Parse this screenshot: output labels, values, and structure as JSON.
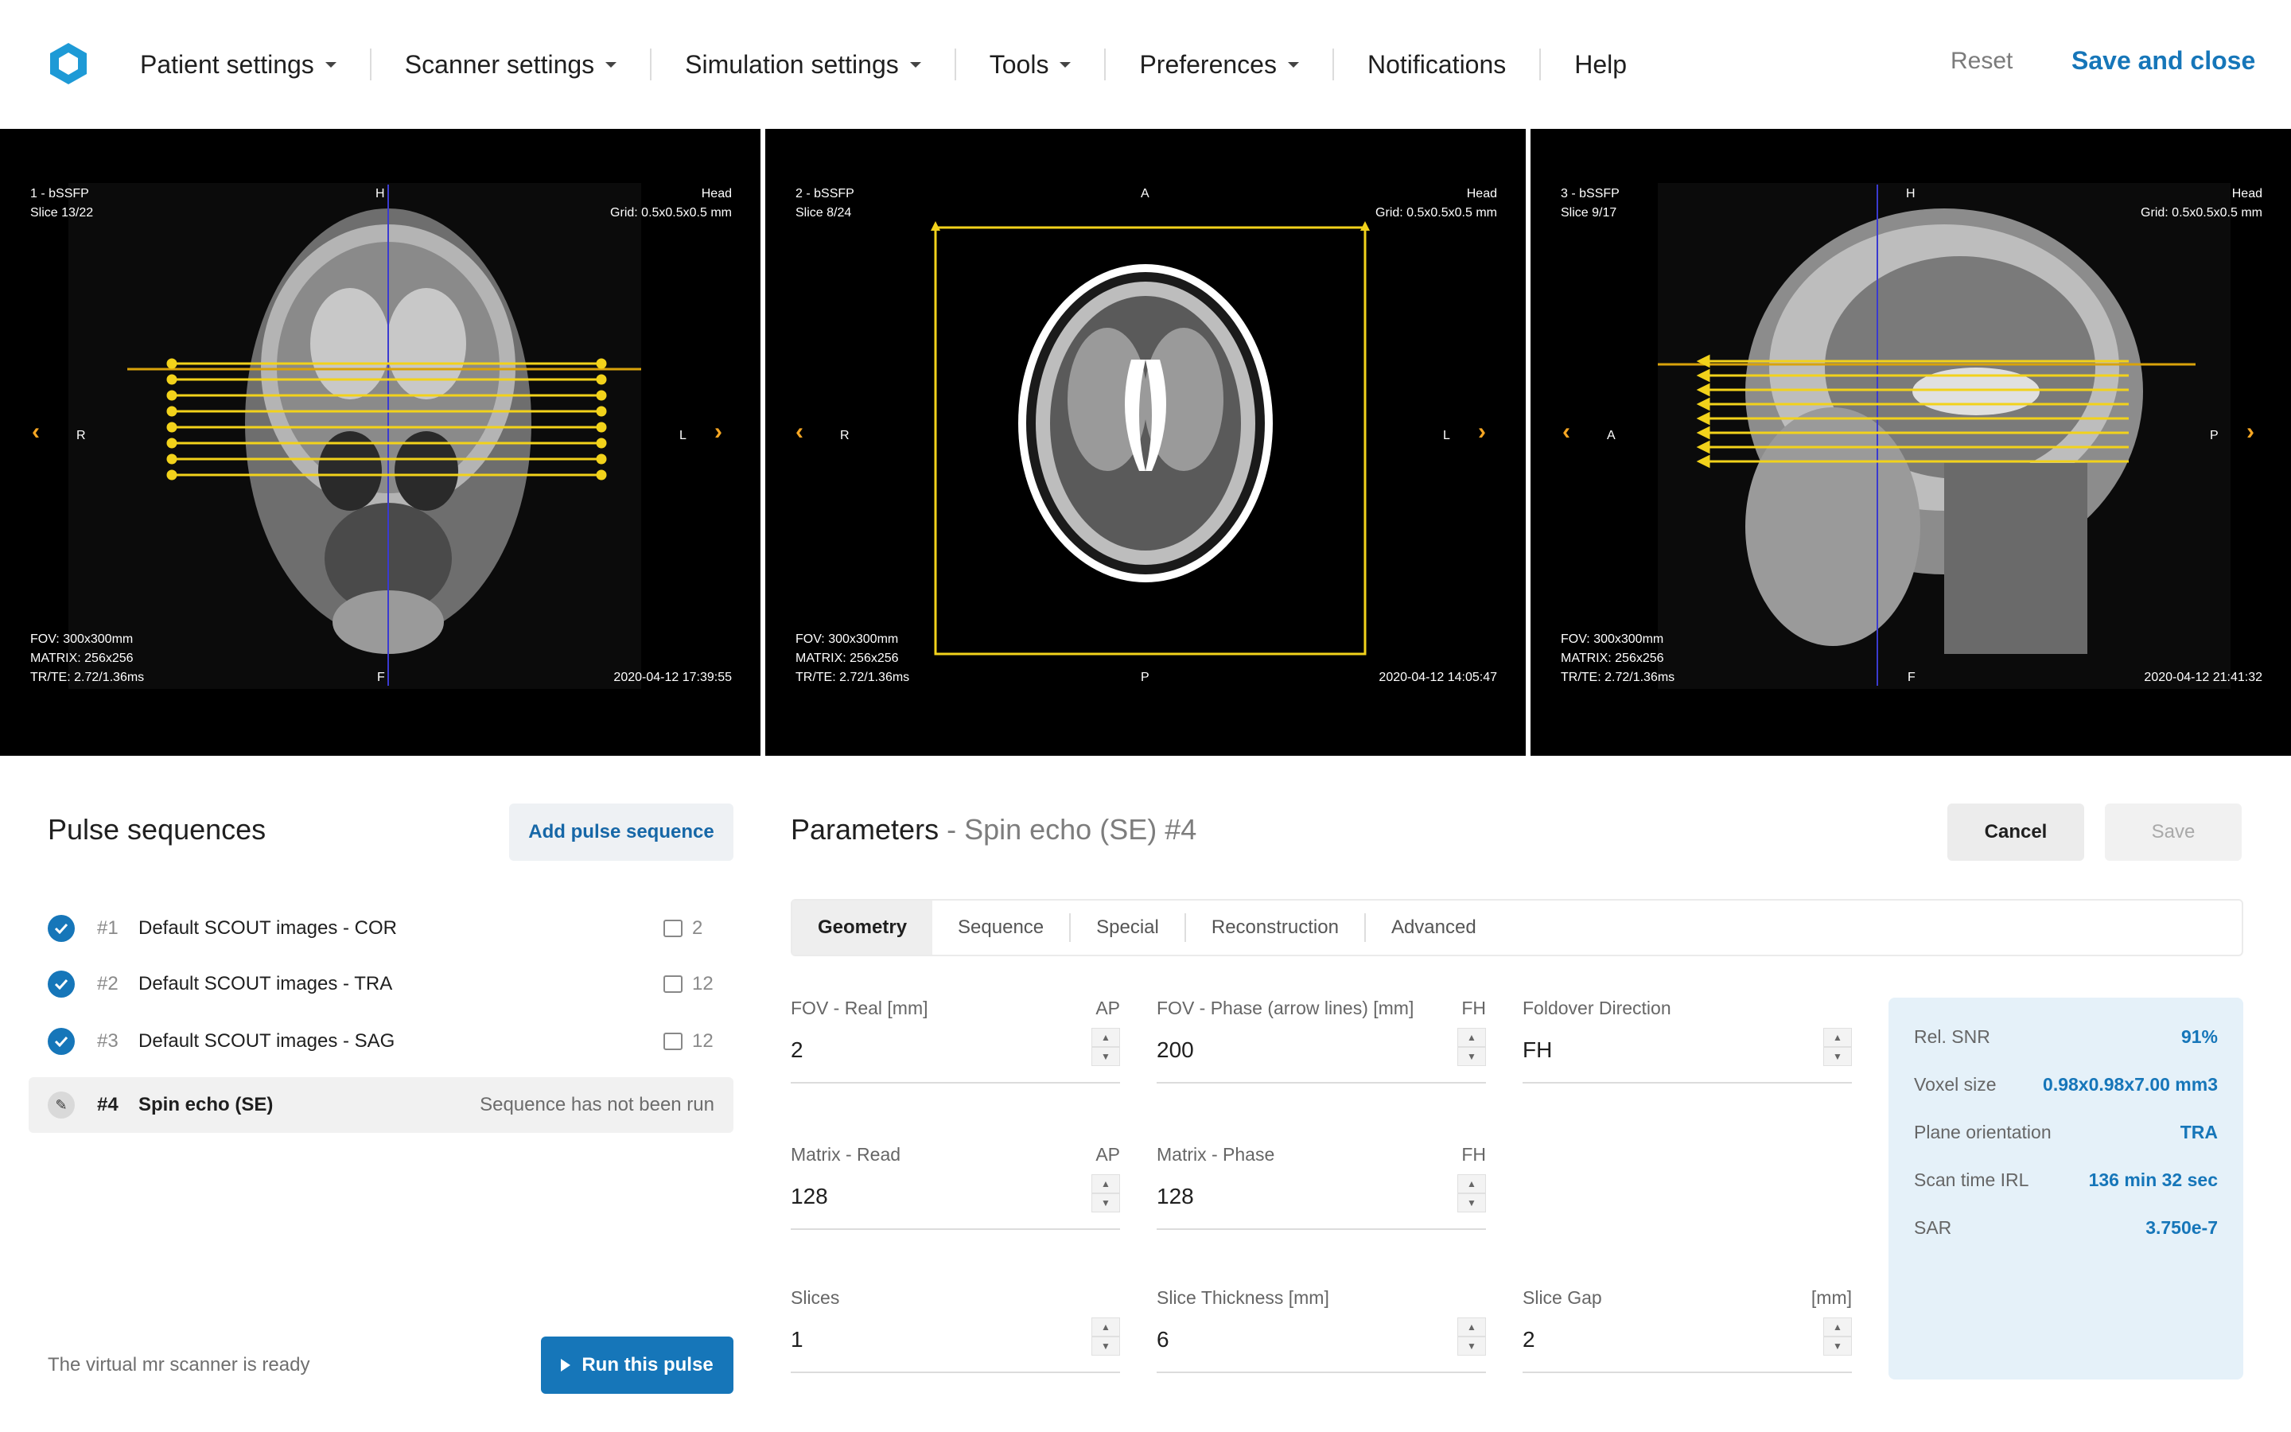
{
  "nav": {
    "items": [
      {
        "label": "Patient settings",
        "dropdown": true
      },
      {
        "label": "Scanner settings",
        "dropdown": true
      },
      {
        "label": "Simulation settings",
        "dropdown": true
      },
      {
        "label": "Tools",
        "dropdown": true
      },
      {
        "label": "Preferences",
        "dropdown": true
      },
      {
        "label": "Notifications",
        "dropdown": false
      },
      {
        "label": "Help",
        "dropdown": false
      }
    ],
    "reset": "Reset",
    "save_close": "Save and close",
    "accent": "#1676b9"
  },
  "viewports": [
    {
      "title": "1 - bSSFP",
      "slice": "Slice 13/22",
      "region": "Head",
      "grid": "Grid: 0.5x0.5x0.5 mm",
      "top": "H",
      "bottom": "F",
      "left": "R",
      "right": "L",
      "fov": "FOV: 300x300mm",
      "matrix": "MATRIX: 256x256",
      "trte": "TR/TE: 2.72/1.36ms",
      "timestamp": "2020-04-12 17:39:55"
    },
    {
      "title": "2 - bSSFP",
      "slice": "Slice 8/24",
      "region": "Head",
      "grid": "Grid: 0.5x0.5x0.5 mm",
      "top": "A",
      "bottom": "P",
      "left": "R",
      "right": "L",
      "fov": "FOV: 300x300mm",
      "matrix": "MATRIX: 256x256",
      "trte": "TR/TE: 2.72/1.36ms",
      "timestamp": "2020-04-12 14:05:47"
    },
    {
      "title": "3 - bSSFP",
      "slice": "Slice 9/17",
      "region": "Head",
      "grid": "Grid: 0.5x0.5x0.5 mm",
      "top": "H",
      "bottom": "F",
      "left": "A",
      "right": "P",
      "fov": "FOV: 300x300mm",
      "matrix": "MATRIX: 256x256",
      "trte": "TR/TE: 2.72/1.36ms",
      "timestamp": "2020-04-12 21:41:32"
    }
  ],
  "pulse_sequences": {
    "title": "Pulse sequences",
    "add_button": "Add pulse sequence",
    "items": [
      {
        "num": "#1",
        "name": "Default SCOUT images - COR",
        "count": "2"
      },
      {
        "num": "#2",
        "name": "Default SCOUT images - TRA",
        "count": "12"
      },
      {
        "num": "#3",
        "name": "Default SCOUT images - SAG",
        "count": "12"
      },
      {
        "num": "#4",
        "name": "Spin echo (SE)",
        "status": "Sequence has not been run"
      }
    ],
    "ready_text": "The virtual mr scanner is ready",
    "run_button": "Run this pulse"
  },
  "parameters": {
    "title": "Parameters",
    "subtitle": "- Spin echo (SE) #4",
    "cancel": "Cancel",
    "save": "Save",
    "tabs": [
      "Geometry",
      "Sequence",
      "Special",
      "Reconstruction",
      "Advanced"
    ],
    "fields": {
      "fov_read": {
        "label": "FOV - Real [mm]",
        "unit": "AP",
        "value": "2"
      },
      "fov_phase": {
        "label": "FOV - Phase (arrow lines) [mm]",
        "unit": "FH",
        "value": "200"
      },
      "foldover": {
        "label": "Foldover Direction",
        "unit": "",
        "value": "FH"
      },
      "matrix_read": {
        "label": "Matrix - Read",
        "unit": "AP",
        "value": "128"
      },
      "matrix_phase": {
        "label": "Matrix - Phase",
        "unit": "FH",
        "value": "128"
      },
      "slices": {
        "label": "Slices",
        "unit": "",
        "value": "1"
      },
      "slice_thickness": {
        "label": "Slice Thickness [mm]",
        "unit": "",
        "value": "6"
      },
      "slice_gap": {
        "label": "Slice Gap",
        "unit": "[mm]",
        "value": "2"
      }
    },
    "stats": [
      {
        "k": "Rel. SNR",
        "v": "91%"
      },
      {
        "k": "Voxel size",
        "v": "0.98x0.98x7.00 mm3"
      },
      {
        "k": "Plane orientation",
        "v": "TRA"
      },
      {
        "k": "Scan time IRL",
        "v": "136 min 32 sec"
      },
      {
        "k": "SAR",
        "v": "3.750e-7"
      }
    ]
  }
}
